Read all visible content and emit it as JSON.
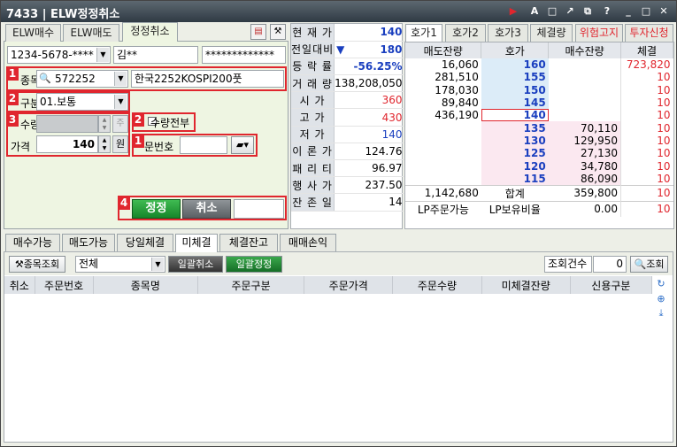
{
  "window": {
    "id": "7433",
    "title": "ELW정정취소"
  },
  "top_tabs": [
    "ELW매수",
    "ELW매도",
    "정정취소"
  ],
  "account": {
    "number": "1234-5678-****",
    "name": "김**",
    "password": "*************"
  },
  "form": {
    "stock_label": "종목",
    "stock_code": "572252",
    "stock_name": "한국2252KOSPI200풋",
    "kind_label": "구분",
    "kind_value": "01.보통",
    "qty_label": "수량",
    "qty_all_label": "수량전부",
    "price_label": "가격",
    "price_value": "140",
    "price_unit": "원",
    "order_no_label": "문번호",
    "steps": {
      "stock": "1",
      "kind": "2",
      "qty": "3",
      "qty_all": "2",
      "order": "1",
      "confirm": "4"
    },
    "modify_button": "정정",
    "cancel_button": "취소",
    "up_glyph": "▲",
    "down_glyph": "▼",
    "upper_glyph": "주"
  },
  "price_panel": [
    {
      "label": "현 재 가",
      "value": "140",
      "color": "#1a3fbf"
    },
    {
      "label": "전일대비",
      "value": "180",
      "color": "#1a3fbf",
      "arrow": "▼"
    },
    {
      "label": "등 락 률",
      "value": "-56.25%",
      "color": "#1a3fbf"
    },
    {
      "label": "거 래 량",
      "value": "138,208,050",
      "color": "#000000"
    },
    {
      "label": "시    가",
      "value": "360",
      "color": "#e0262e"
    },
    {
      "label": "고    가",
      "value": "430",
      "color": "#e0262e"
    },
    {
      "label": "저    가",
      "value": "140",
      "color": "#1a3fbf"
    },
    {
      "label": "이 론 가",
      "value": "124.76",
      "color": "#000000"
    },
    {
      "label": "패 리 티",
      "value": "96.97",
      "color": "#000000"
    },
    {
      "label": "행 사 가",
      "value": "237.50",
      "color": "#000000"
    },
    {
      "label": "잔 존 일",
      "value": "14",
      "color": "#000000"
    }
  ],
  "orderbook_tabs": [
    "호가1",
    "호가2",
    "호가3",
    "체결량",
    "위험고지",
    "투자신청"
  ],
  "orderbook_headers": [
    "매도잔량",
    "호가",
    "매수잔량",
    "체결"
  ],
  "asks": [
    {
      "qty": "16,060",
      "price": "160"
    },
    {
      "qty": "281,510",
      "price": "155"
    },
    {
      "qty": "178,030",
      "price": "150"
    },
    {
      "qty": "89,840",
      "price": "145"
    },
    {
      "qty": "436,190",
      "price": "140"
    }
  ],
  "bids": [
    {
      "qty": "70,110",
      "price": "135"
    },
    {
      "qty": "129,950",
      "price": "130"
    },
    {
      "qty": "27,130",
      "price": "125"
    },
    {
      "qty": "34,780",
      "price": "120"
    },
    {
      "qty": "86,090",
      "price": "115"
    }
  ],
  "trades": [
    "723,820",
    "10",
    "10",
    "10",
    "10",
    "10",
    "10",
    "10",
    "10",
    "10",
    "10",
    "10",
    "10"
  ],
  "totals": {
    "ask_total": "1,142,680",
    "label": "합계",
    "bid_total": "359,800"
  },
  "lp": {
    "order_label": "LP주문가능",
    "ratio_label": "LP보유비율",
    "ratio_value": "0.00"
  },
  "bottom_tabs": [
    "매수가능",
    "매도가능",
    "당일체결",
    "미체결",
    "체결잔고",
    "매매손익"
  ],
  "toolbar": {
    "stock_search": "종목조회",
    "filter_value": "전체",
    "bulk_cancel": "일괄취소",
    "bulk_modify": "일괄정정",
    "count_label": "조회건수",
    "count_value": "0",
    "search_button": "조회"
  },
  "columns": [
    "취소",
    "주문번호",
    "종목명",
    "주문구분",
    "주문가격",
    "주문수량",
    "미체결잔량",
    "신용구분"
  ]
}
